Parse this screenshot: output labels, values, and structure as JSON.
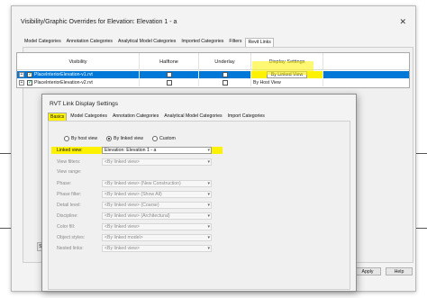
{
  "outer_dialog": {
    "title": "Visibility/Graphic Overrides for Elevation: Elevation 1 - a",
    "tabs": [
      {
        "label": "Model Categories"
      },
      {
        "label": "Annotation Categories"
      },
      {
        "label": "Analytical Model Categories"
      },
      {
        "label": "Imported Categories"
      },
      {
        "label": "Filters"
      },
      {
        "label": "Revit Links"
      }
    ],
    "table": {
      "columns": {
        "visibility": "Visibility",
        "halftone": "Halftone",
        "underlay": "Underlay",
        "display_settings": "Display Settings"
      },
      "rows": [
        {
          "name": "PlaceInteriorElevation-v1.rvt",
          "expand": "+",
          "display": "By Linked View"
        },
        {
          "name": "PlaceInteriorElevation-v2.rvt",
          "expand": "+",
          "display": "By Host View"
        }
      ]
    },
    "buttons": {
      "set": "Set",
      "apply": "Apply",
      "help": "Help"
    }
  },
  "inner_dialog": {
    "title": "RVT Link Display Settings",
    "tabs": [
      {
        "label": "Basics"
      },
      {
        "label": "Model Categories"
      },
      {
        "label": "Annotation Categories"
      },
      {
        "label": "Analytical Model Categories"
      },
      {
        "label": "Import Categories"
      }
    ],
    "radio_options": [
      {
        "label": "By host view"
      },
      {
        "label": "By linked view"
      },
      {
        "label": "Custom"
      }
    ],
    "fields": [
      {
        "label": "Linked view:",
        "value": "Elevation: Elevation 1 - a"
      },
      {
        "label": "View filters:",
        "value": "<By linked view>"
      },
      {
        "label": "View range:",
        "value": ""
      },
      {
        "label": "Phase:",
        "value": "<By linked view> (New Construction)"
      },
      {
        "label": "Phase filter:",
        "value": "<By linked view> (Show All)"
      },
      {
        "label": "Detail level:",
        "value": "<By linked view> (Coarse)"
      },
      {
        "label": "Discipline:",
        "value": "<By linked view> (Architectural)"
      },
      {
        "label": "Color fill:",
        "value": "<By linked view>"
      },
      {
        "label": "Object styles:",
        "value": "<By linked model>"
      },
      {
        "label": "Nested links:",
        "value": "<By linked view>"
      }
    ]
  },
  "colors": {
    "highlight": "#fff200",
    "selection": "#0078d7"
  }
}
